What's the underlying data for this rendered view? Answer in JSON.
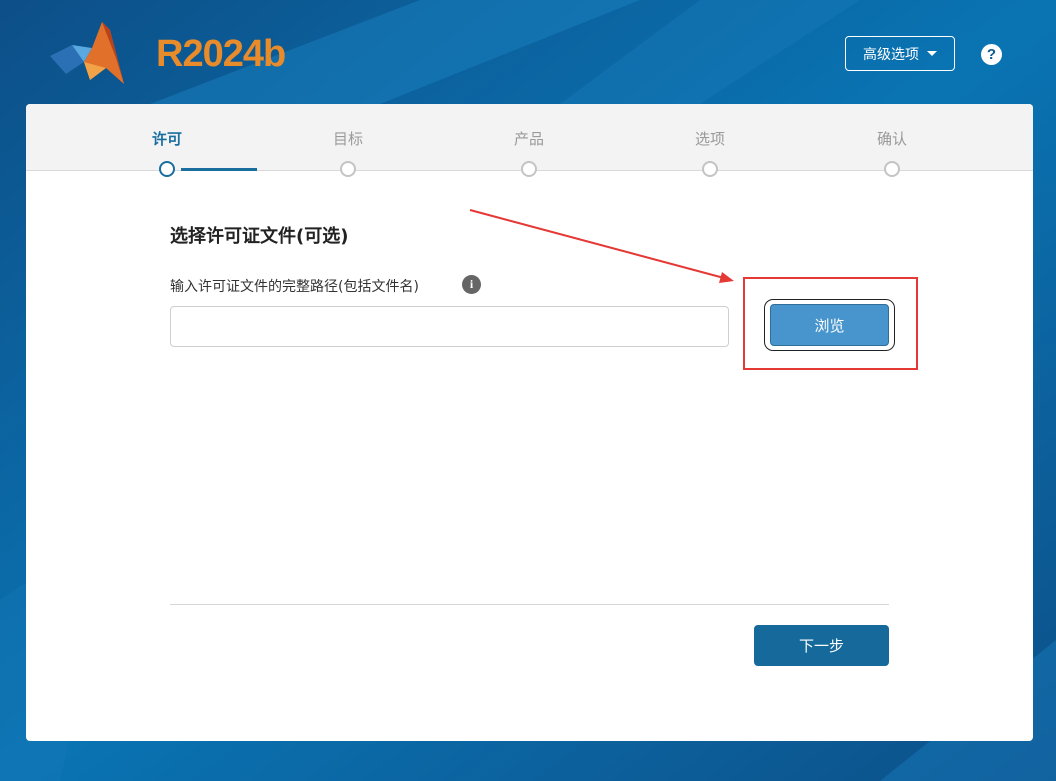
{
  "header": {
    "version": {
      "prefix": "R",
      "number": "2024",
      "suffix": "b"
    },
    "advanced_options": "高级选项",
    "help": "?"
  },
  "steps": [
    {
      "label": "许可",
      "active": true
    },
    {
      "label": "目标",
      "active": false
    },
    {
      "label": "产品",
      "active": false
    },
    {
      "label": "选项",
      "active": false
    },
    {
      "label": "确认",
      "active": false
    }
  ],
  "main": {
    "section_title": "选择许可证文件(可选)",
    "field_label": "输入许可证文件的完整路径(包括文件名)",
    "info_icon": "i",
    "path_value": "",
    "browse_label": "浏览",
    "next_label": "下一步"
  },
  "colors": {
    "brand_orange": "#e88b2a",
    "accent_blue": "#1a6e9f",
    "browse_blue": "#4795cc",
    "annotation_red": "#e53935"
  },
  "icons": {
    "logo": "matlab-membrane-logo",
    "caret": "caret-down-icon",
    "help": "help-circle-icon",
    "info": "info-circle-icon"
  }
}
